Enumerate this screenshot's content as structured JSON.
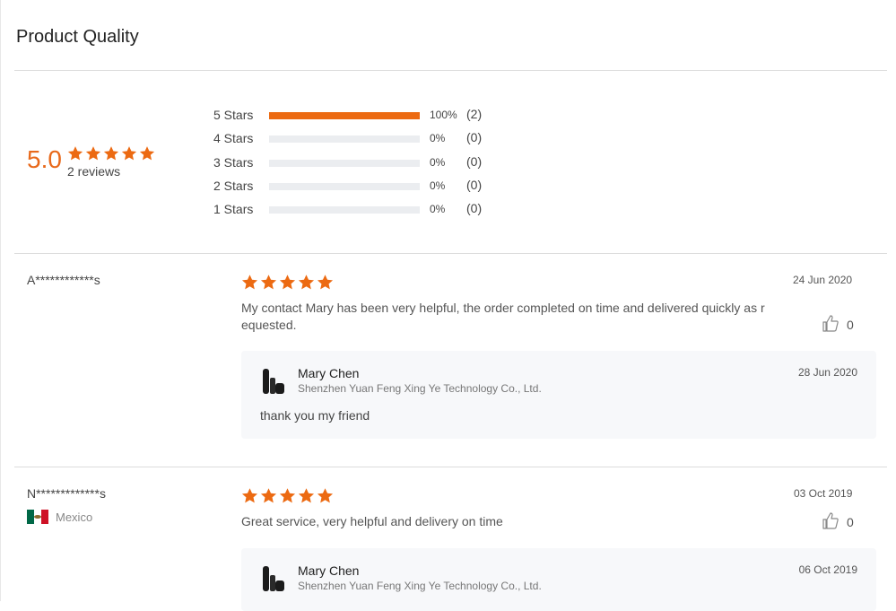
{
  "section": {
    "title": "Product Quality"
  },
  "summary": {
    "score": "5.0",
    "stars": 5,
    "reviews_label": "2 reviews",
    "accent_color": "#EC6A12",
    "distribution": [
      {
        "label": "5  Stars",
        "percent_label": "100%",
        "count_label": "(2)",
        "fraction": 1.0
      },
      {
        "label": "4  Stars",
        "percent_label": "0%",
        "count_label": "(0)",
        "fraction": 0
      },
      {
        "label": "3  Stars",
        "percent_label": "0%",
        "count_label": "(0)",
        "fraction": 0
      },
      {
        "label": "2  Stars",
        "percent_label": "0%",
        "count_label": "(0)",
        "fraction": 0
      },
      {
        "label": "1  Stars",
        "percent_label": "0%",
        "count_label": "(0)",
        "fraction": 0
      }
    ]
  },
  "reviews": [
    {
      "reviewer": "A************s",
      "country": "",
      "rating": 5,
      "date": "24 Jun 2020",
      "text": "My contact Mary has been very helpful, the order completed on time and delivered quickly as requested.",
      "likes": "0",
      "like_icon": "thumbs-up-icon",
      "reply": {
        "name": "Mary Chen",
        "company": "Shenzhen Yuan Feng Xing Ye Technology Co., Ltd.",
        "date": "28 Jun 2020",
        "text": "thank you my friend"
      }
    },
    {
      "reviewer": "N*************s",
      "country": "Mexico",
      "country_flag": "mexico-flag-icon",
      "rating": 5,
      "date": "03 Oct 2019",
      "text": "Great service, very helpful and delivery on time",
      "likes": "0",
      "like_icon": "thumbs-up-icon",
      "reply": {
        "name": "Mary Chen",
        "company": "Shenzhen Yuan Feng Xing Ye Technology Co., Ltd.",
        "date": "06 Oct 2019",
        "text": ""
      }
    }
  ]
}
